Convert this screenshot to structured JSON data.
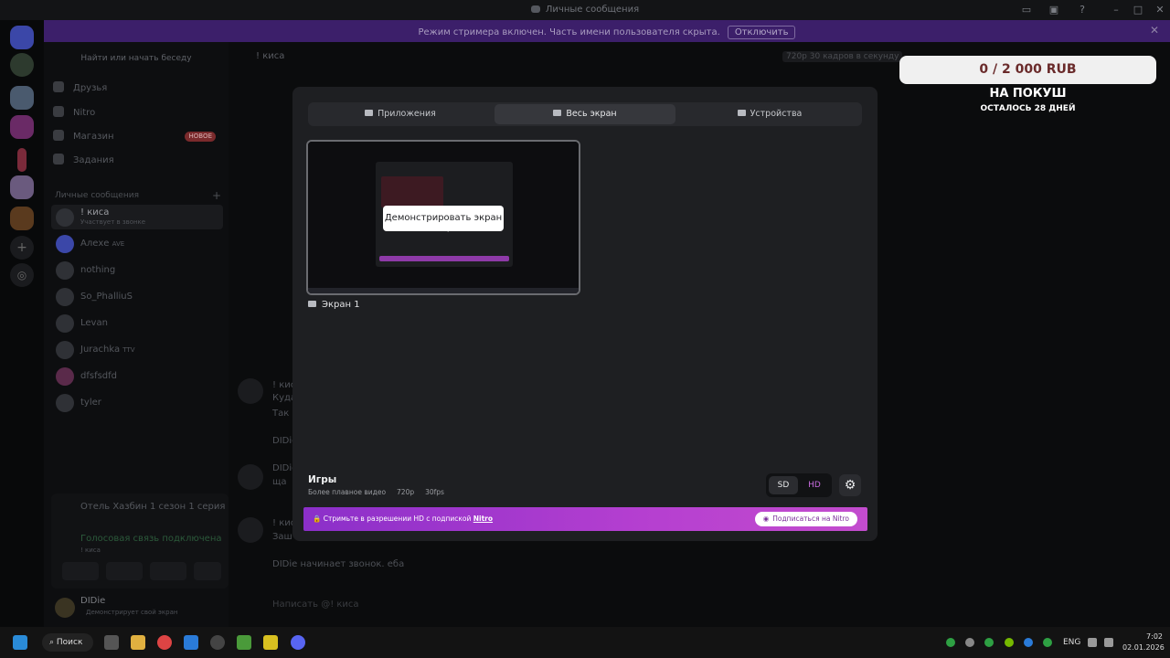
{
  "window": {
    "title": "Личные сообщения"
  },
  "banner": {
    "text": "Режим стримера включен. Часть имени пользователя скрыта.",
    "button": "Отключить"
  },
  "sidebar": {
    "search_placeholder": "Найти или начать беседу",
    "nav": [
      {
        "label": "Друзья"
      },
      {
        "label": "Nitro"
      },
      {
        "label": "Магазин",
        "badge": "НОВОЕ"
      },
      {
        "label": "Задания"
      }
    ],
    "dm_header": "Личные сообщения",
    "dms": [
      {
        "name": "! киса",
        "sub": "Участвует в звонке"
      },
      {
        "name": "Алехе",
        "tag": "AVE"
      },
      {
        "name": "nothing"
      },
      {
        "name": "So_PhalliuS"
      },
      {
        "name": "Levan"
      },
      {
        "name": "Jurachka",
        "tag": "TTV"
      },
      {
        "name": "dfsfsdfd"
      },
      {
        "name": "tyler"
      }
    ],
    "activity": "Отель Хазбин 1 сезон 1 серия смот...",
    "voice_status": "Голосовая связь подключена",
    "voice_room": "! киса",
    "user": {
      "name": "DIDie",
      "status": "Демонстрирует свой экран"
    }
  },
  "chat": {
    "header_name": "! киса",
    "quality": "720p 30 кадров в секунду",
    "messages": [
      {
        "author": "! киса",
        "line1": "Куда",
        "line2": "Так п"
      },
      {
        "author": "DIDie"
      },
      {
        "author": "DIDie",
        "line1": "ща"
      },
      {
        "author": "! киса",
        "line1": "Заш"
      },
      {
        "author": "DIDie",
        "text": "начинает звонок. еба"
      }
    ],
    "composer_placeholder": "Написать @! киса"
  },
  "goal": {
    "progress": "0 / 2 000 RUB",
    "title": "НА ПОКУШ",
    "days": "ОСТАЛОСЬ 28 ДНЕЙ"
  },
  "modal": {
    "tabs": [
      {
        "label": "Приложения"
      },
      {
        "label": "Весь экран",
        "active": true
      },
      {
        "label": "Устройства"
      }
    ],
    "share_button": "Демонстрировать экран",
    "screen_label": "Экран 1",
    "preset_title": "Игры",
    "preset_desc": "Более плавное видео",
    "preset_res": "720p",
    "preset_fps": "30fps",
    "quality_sd": "SD",
    "quality_hd": "HD",
    "nitro_text": "Стримьте в разрешении HD с подпиской",
    "nitro_link": "Nitro",
    "nitro_button": "Подписаться на Nitro"
  },
  "taskbar": {
    "search": "Поиск",
    "lang": "ENG",
    "time": "7:02",
    "date": "02.01.2026"
  },
  "colors": {
    "accent": "#5865f2",
    "nitro_gradient_start": "#8b2fc9",
    "nitro_gradient_end": "#c34cce",
    "banner": "#3c1f6a"
  }
}
